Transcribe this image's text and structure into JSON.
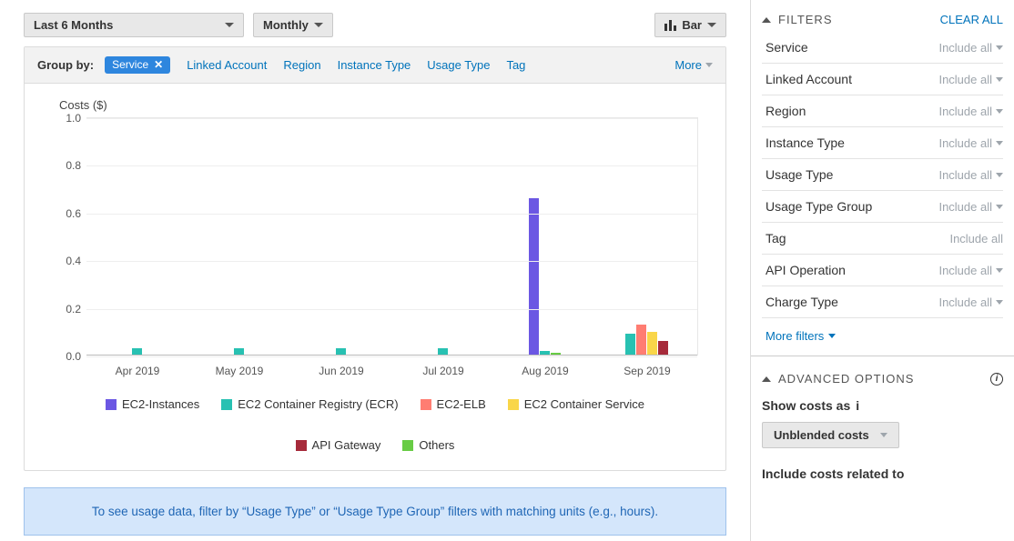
{
  "toolbar": {
    "range": "Last 6 Months",
    "granularity": "Monthly",
    "chart_type": "Bar"
  },
  "groupby": {
    "label": "Group by:",
    "selected": "Service",
    "options": [
      "Linked Account",
      "Region",
      "Instance Type",
      "Usage Type",
      "Tag"
    ],
    "more": "More"
  },
  "chart": {
    "ylabel": "Costs ($)"
  },
  "info": "To see usage data, filter by “Usage Type” or “Usage Type Group” filters with matching units (e.g., hours).",
  "filters": {
    "header": "FILTERS",
    "clear": "CLEAR ALL",
    "include": "Include all",
    "items": [
      "Service",
      "Linked Account",
      "Region",
      "Instance Type",
      "Usage Type",
      "Usage Type Group",
      "Tag",
      "API Operation",
      "Charge Type"
    ],
    "no_caret": [
      "Tag"
    ],
    "more": "More filters"
  },
  "advanced": {
    "header": "ADVANCED OPTIONS",
    "show_label": "Show costs as",
    "show_value": "Unblended costs",
    "include_label": "Include costs related to"
  },
  "chart_data": {
    "type": "bar",
    "title": "Costs ($)",
    "xlabel": "",
    "ylabel": "Costs ($)",
    "ylim": [
      0,
      1.0
    ],
    "yticks": [
      0.0,
      0.2,
      0.4,
      0.6,
      0.8,
      1.0
    ],
    "categories": [
      "Apr 2019",
      "May 2019",
      "Jun 2019",
      "Jul 2019",
      "Aug 2019",
      "Sep 2019"
    ],
    "series": [
      {
        "name": "EC2-Instances",
        "color": "#6b57e3",
        "values": [
          0,
          0,
          0,
          0,
          0.66,
          0
        ]
      },
      {
        "name": "EC2 Container Registry (ECR)",
        "color": "#28c1b2",
        "values": [
          0.03,
          0.03,
          0.03,
          0.03,
          0.02,
          0.09
        ]
      },
      {
        "name": "EC2-ELB",
        "color": "#ff7d72",
        "values": [
          0,
          0,
          0,
          0,
          0,
          0.13
        ]
      },
      {
        "name": "EC2 Container Service",
        "color": "#f9d649",
        "values": [
          0,
          0,
          0,
          0,
          0,
          0.1
        ]
      },
      {
        "name": "API Gateway",
        "color": "#a62a3a",
        "values": [
          0,
          0,
          0,
          0,
          0,
          0.06
        ]
      },
      {
        "name": "Others",
        "color": "#68cc45",
        "values": [
          0,
          0,
          0,
          0,
          0.01,
          0
        ]
      }
    ]
  }
}
